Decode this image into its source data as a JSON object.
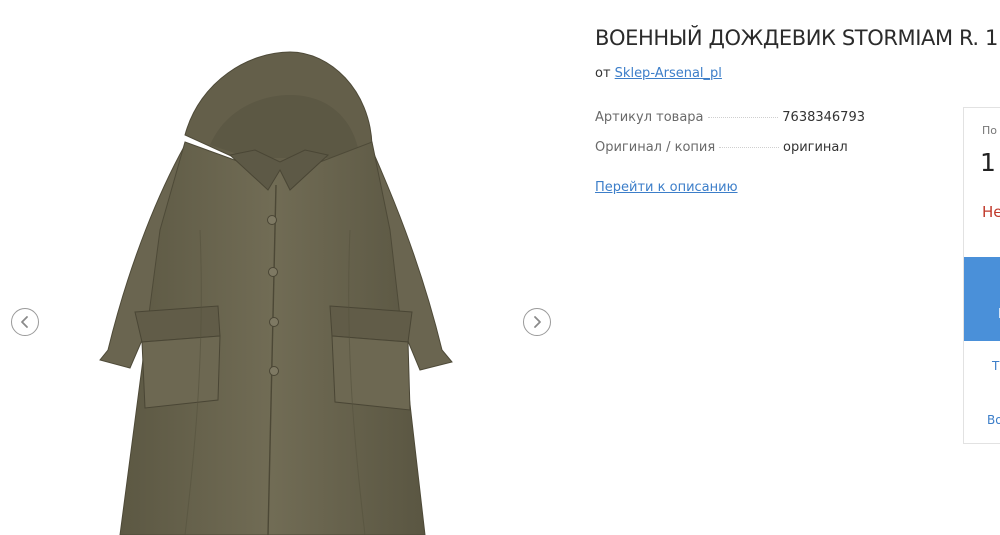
{
  "product": {
    "title": "ВОЕННЫЙ ДОЖДЕВИК STORMIAM R. 1",
    "seller_prefix": "от",
    "seller_name": "Sklep-Arsenal_pl",
    "image_alt": "raincoat-photo",
    "specs": [
      {
        "label": "Артикул товара",
        "value": "7638346793"
      },
      {
        "label": "Оригинал / копия",
        "value": "оригинал"
      }
    ],
    "description_link": "Перейти к описанию"
  },
  "gallery": {
    "prev_icon": "chevron-left-icon",
    "next_icon": "chevron-right-icon"
  },
  "buybox": {
    "label": "По",
    "price": "1",
    "status": "Не",
    "button_text": "Г",
    "link1": "Т",
    "link2": "Во",
    "status_color": "#c0392b",
    "button_color": "#4a90d9"
  },
  "colors": {
    "link": "#3c7ec9",
    "coat": "#6b6650",
    "coat_dark": "#4e4a38"
  }
}
